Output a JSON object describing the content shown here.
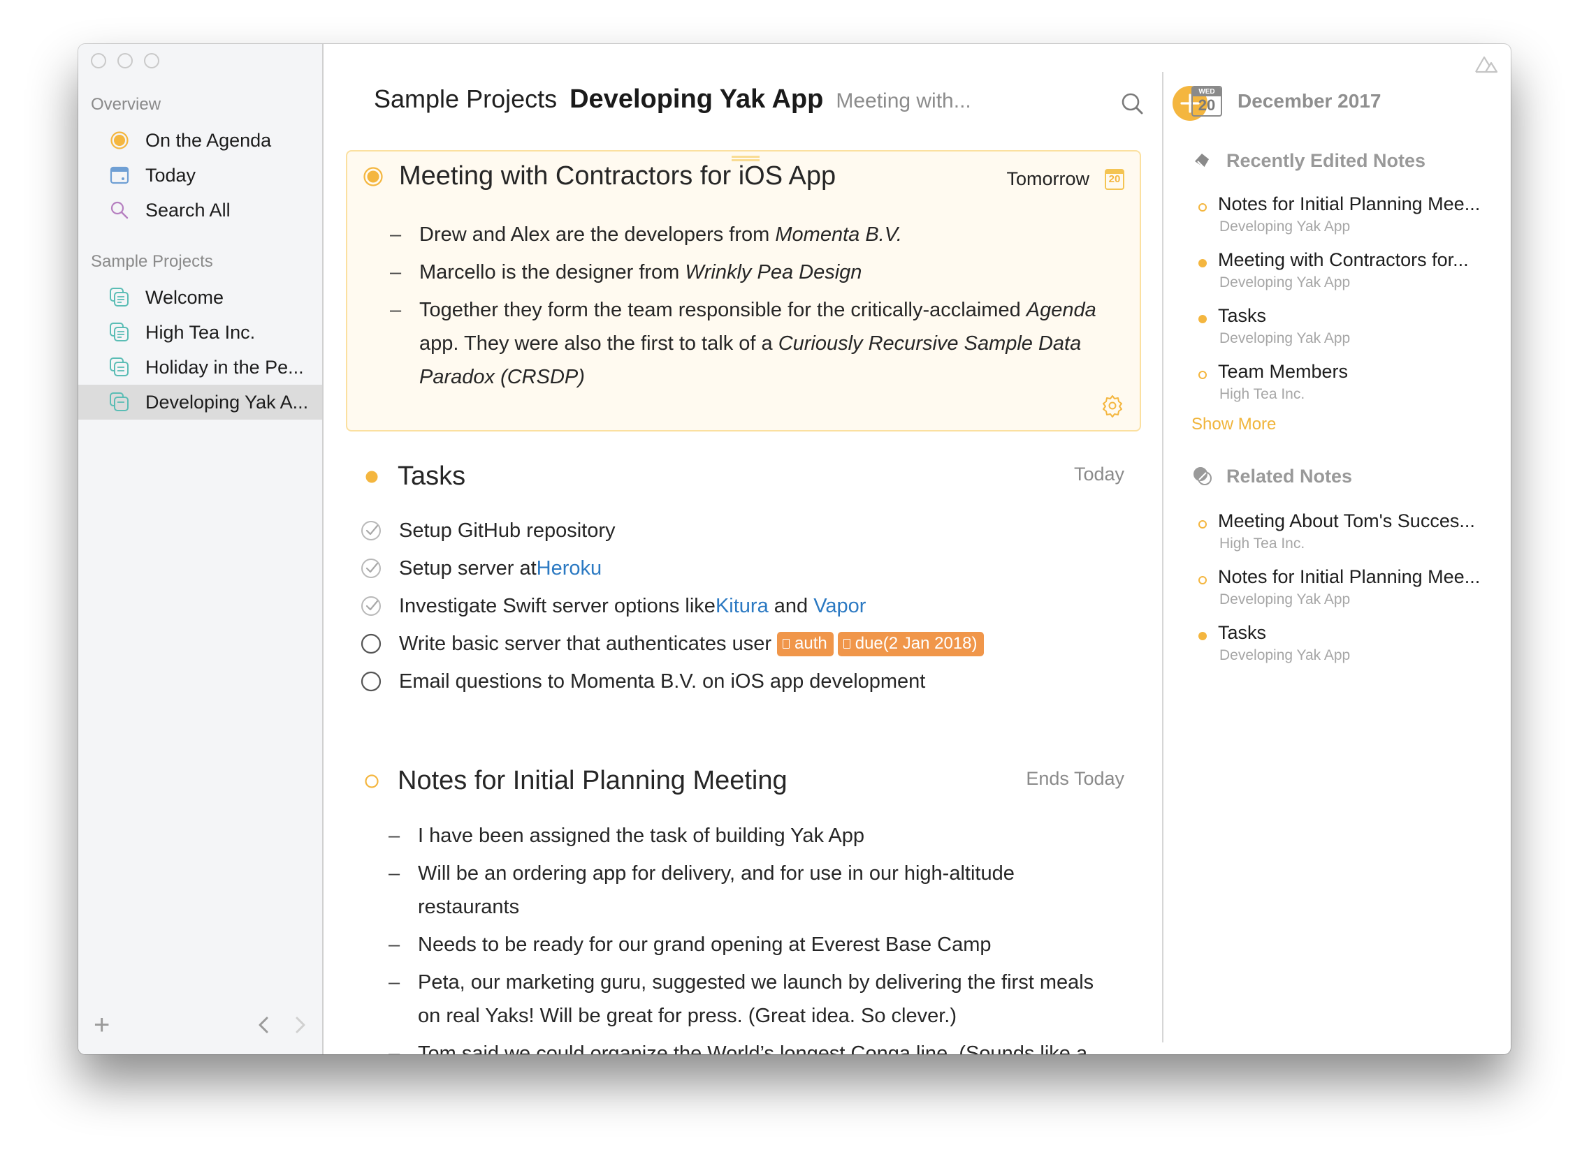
{
  "window": {
    "controls": [
      "close",
      "minimize",
      "zoom"
    ]
  },
  "sidebar": {
    "overview_label": "Overview",
    "overview_items": [
      {
        "label": "On the Agenda",
        "icon": "agenda-radio-icon"
      },
      {
        "label": "Today",
        "icon": "calendar-today-icon"
      },
      {
        "label": "Search All",
        "icon": "search-icon"
      }
    ],
    "projects_label": "Sample Projects",
    "projects": [
      {
        "label": "Welcome",
        "icon": "project-notes-icon",
        "selected": false
      },
      {
        "label": "High Tea Inc.",
        "icon": "project-notes-icon",
        "selected": false
      },
      {
        "label": "Holiday in the Pe...",
        "icon": "project-notes-icon",
        "selected": false
      },
      {
        "label": "Developing Yak A...",
        "icon": "project-notes-icon",
        "selected": true
      }
    ],
    "add_label": "+"
  },
  "header": {
    "breadcrumb": "Sample Projects",
    "title": "Developing Yak App",
    "subtitle": "Meeting with..."
  },
  "notes": {
    "meeting": {
      "title": "Meeting with Contractors for iOS App",
      "date": "Tomorrow",
      "calendar_day": "20",
      "status": "on-agenda",
      "bullets": [
        {
          "text": "Drew and Alex are the developers from ",
          "em": "Momenta B.V."
        },
        {
          "text": "Marcello is the designer from ",
          "em": "Wrinkly Pea Design"
        },
        {
          "line1_pre": "Together they form the team responsible for the critically-acclaimed ",
          "line1_em": "Agenda",
          "line2_pre": "app. They were also the first to talk of a ",
          "line2_em": "Curiously Recursive Sample Data",
          "line3_em": "Paradox (CRSDP)"
        }
      ]
    },
    "tasks": {
      "title": "Tasks",
      "date": "Today",
      "items": [
        {
          "text": "Setup GitHub repository",
          "done": true
        },
        {
          "text": "Setup server at ",
          "link": "Heroku",
          "done": true
        },
        {
          "text": "Investigate Swift server options like ",
          "link": "Kitura",
          "mid": " and ",
          "link2": "Vapor",
          "done": true
        },
        {
          "text": "Write basic server that authenticates user",
          "done": false,
          "tags": [
            "auth",
            "due(2 Jan 2018)"
          ]
        },
        {
          "text": "Email questions to Momenta B.V. on iOS app development",
          "done": false
        }
      ]
    },
    "planning": {
      "title": "Notes for Initial Planning Meeting",
      "date": "Ends Today",
      "bullets": [
        "I have been assigned the task of building Yak App",
        "Will be an ordering app for delivery, and for use in our high-altitude",
        "restaurants",
        "Needs to be ready for our grand opening at Everest Base Camp",
        "Peta, our marketing guru, suggested we launch by delivering the first meals",
        "on real Yaks! Will be great for press. (Great idea. So clever.)",
        "Tom said we could organize the World’s longest Conga line. (Sounds like a"
      ]
    }
  },
  "right_panel": {
    "calendar": {
      "weekday": "WED",
      "day": "20",
      "month_year": "December 2017"
    },
    "recent_label": "Recently Edited Notes",
    "recent": [
      {
        "title": "Notes for Initial Planning Mee...",
        "project": "Developing Yak App",
        "dot": "hollow"
      },
      {
        "title": "Meeting with Contractors for...",
        "project": "Developing Yak App",
        "dot": "filled"
      },
      {
        "title": "Tasks",
        "project": "Developing Yak App",
        "dot": "filled"
      },
      {
        "title": "Team Members",
        "project": "High Tea Inc.",
        "dot": "hollow"
      }
    ],
    "show_more": "Show More",
    "related_label": "Related Notes",
    "related": [
      {
        "title": "Meeting About Tom's Succes...",
        "project": "High Tea Inc.",
        "dot": "hollow"
      },
      {
        "title": "Notes for Initial Planning Mee...",
        "project": "Developing Yak App",
        "dot": "hollow"
      },
      {
        "title": "Tasks",
        "project": "Developing Yak App",
        "dot": "filled"
      }
    ]
  },
  "colors": {
    "accent": "#f4b63f",
    "tag": "#f0964a",
    "link": "#2b79c2",
    "card_bg": "#fffaf0",
    "card_border": "#fbe0a0",
    "project_icon": "#5bbdb5"
  }
}
